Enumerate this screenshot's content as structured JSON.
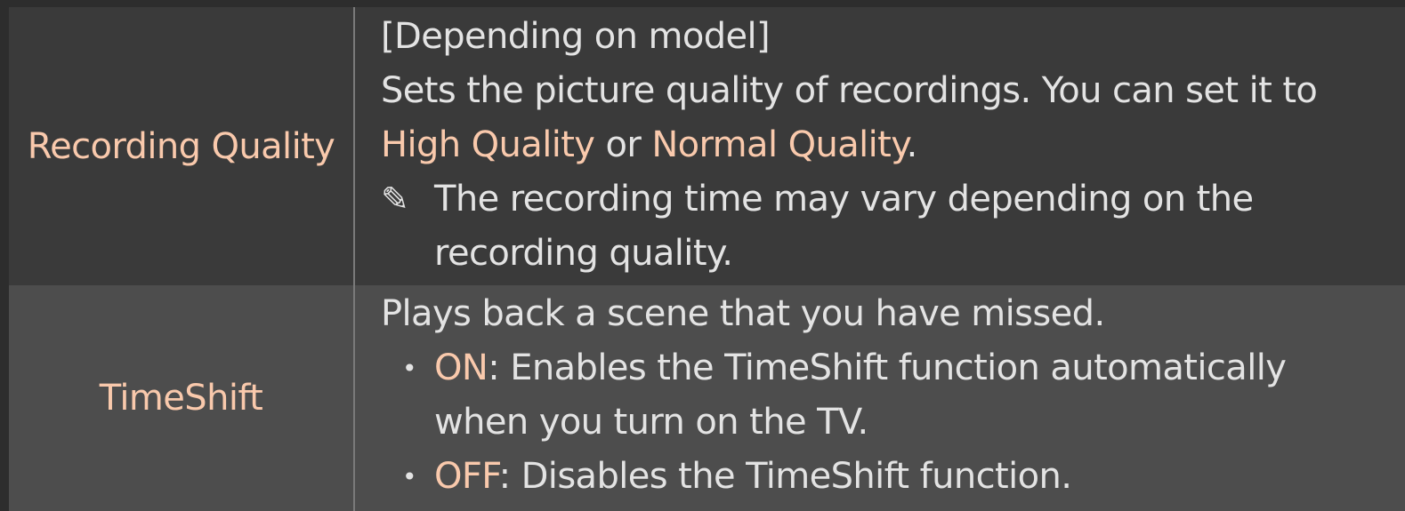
{
  "rows": [
    {
      "label": "Recording Quality",
      "model_note": "[Depending on model]",
      "desc_part1": "Sets the picture quality of recordings. You can set it to",
      "option_high": "High Quality",
      "or_text": " or ",
      "option_normal": "Normal Quality",
      "period": ".",
      "note_icon": "pencil-note-icon",
      "note_line1": "The recording time may vary depending on the",
      "note_line2": "recording quality."
    },
    {
      "label": "TimeShift",
      "desc": "Plays back a scene that you have missed.",
      "bullet_glyph": "•",
      "on_label": "ON",
      "on_desc_line1": ": Enables the TimeShift function automatically",
      "on_desc_line2": "when you turn on the TV.",
      "off_label": "OFF",
      "off_desc": ": Disables the TimeShift function."
    }
  ],
  "colors": {
    "background": "#2d2d2d",
    "row1_bg": "#3a3a3a",
    "row2_bg": "#4d4d4d",
    "accent": "#f9c9ac",
    "text": "#e3e3e3",
    "divider": "#7a7a7a"
  }
}
